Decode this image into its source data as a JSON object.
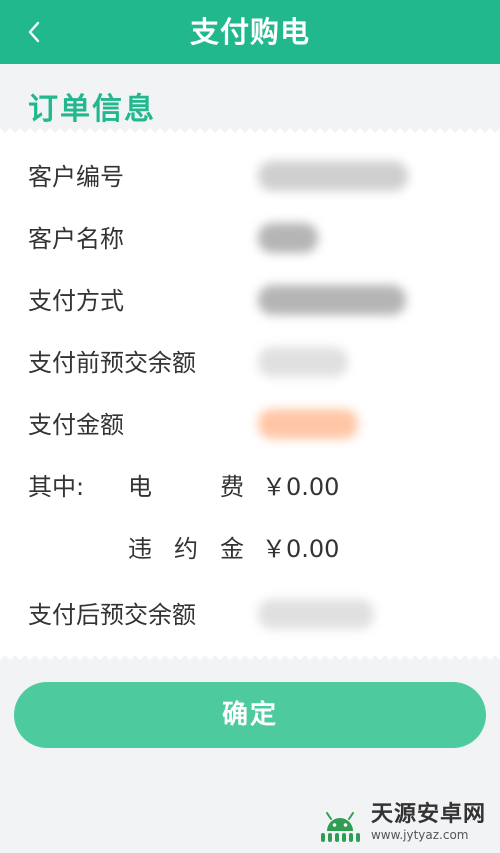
{
  "header": {
    "title": "支付购电",
    "back_icon": "chevron-left-icon"
  },
  "section": {
    "title": "订单信息"
  },
  "order": {
    "customer_no_label": "客户编号",
    "customer_name_label": "客户名称",
    "pay_method_label": "支付方式",
    "pre_balance_label": "支付前预交余额",
    "pay_amount_label": "支付金额",
    "breakdown_prefix": "其中:",
    "fee_char1": "电",
    "fee_char2": "费",
    "fee_value": "￥0.00",
    "penalty_char1": "违",
    "penalty_char2": "约",
    "penalty_char3": "金",
    "penalty_value": "￥0.00",
    "post_balance_label": "支付后预交余额"
  },
  "actions": {
    "confirm_label": "确定"
  },
  "watermark": {
    "name": "天源安卓网",
    "url": "www.jytyaz.com"
  },
  "colors": {
    "primary": "#22b88d",
    "button": "#4ecb9e",
    "amount_highlight": "#ffc6a6",
    "background": "#f2f3f5"
  }
}
